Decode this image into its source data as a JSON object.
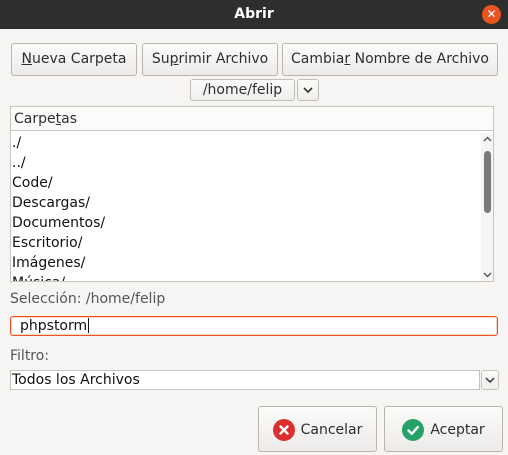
{
  "window": {
    "title": "Abrir"
  },
  "toolbar": {
    "new_folder": {
      "pre": "",
      "key": "N",
      "post": "ueva Carpeta"
    },
    "delete_file": {
      "pre": "Su",
      "key": "p",
      "post": "rimir Archivo"
    },
    "rename_file": {
      "pre": "Cambia",
      "key": "r",
      "post": " Nombre de Archivo"
    }
  },
  "path": {
    "current": "/home/felip"
  },
  "folders": {
    "header": {
      "pre": "Carpe",
      "key": "t",
      "post": "as"
    },
    "items": [
      "./",
      "../",
      "Code/",
      "Descargas/",
      "Documentos/",
      "Escritorio/",
      "Imágenes/",
      "Música/"
    ]
  },
  "selection": {
    "label": "Selección: /home/felip",
    "value": "phpstorm"
  },
  "filter": {
    "label": "Filtro:",
    "value": "Todos los Archivos"
  },
  "actions": {
    "cancel": "Cancelar",
    "accept": "Aceptar"
  },
  "colors": {
    "accent": "#e95420",
    "titlebar": "#2e2e2e",
    "cancel_icon": "#d9302e",
    "accept_icon": "#26a269"
  }
}
